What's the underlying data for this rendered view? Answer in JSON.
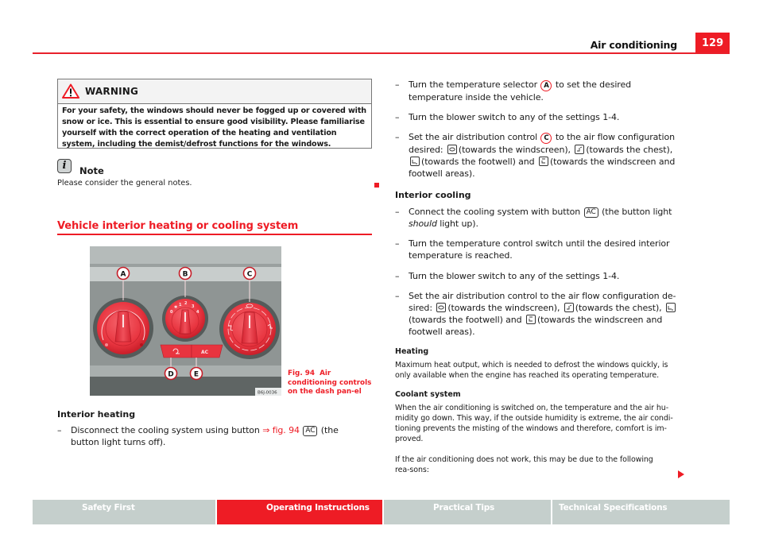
{
  "header": {
    "section_title": "Air conditioning",
    "page_number": "129"
  },
  "warning": {
    "title": "WARNING",
    "text": "For your safety, the windows should never be fogged up or covered with snow or ice. This is essential to ensure good visibility. Please familiarise yourself with the correct operation of the heating and ventilation system, including the demist/defrost functions for the windows."
  },
  "note": {
    "title": "Note",
    "text": "Please consider the general notes."
  },
  "section": {
    "title": "Vehicle interior heating or cooling system"
  },
  "figure": {
    "callouts": [
      "A",
      "B",
      "C",
      "D",
      "E"
    ],
    "blower_settings": [
      "0",
      "✱",
      "1",
      "2",
      "3",
      "4"
    ],
    "ac_button_label": "AC",
    "image_code": "B6J-0036",
    "caption_number": "Fig. 94",
    "caption_text": "Air conditioning controls on the dash pan-el"
  },
  "interior_heating": {
    "heading": "Interior heating",
    "items": [
      {
        "dash": "–",
        "parts": [
          "Disconnect the cooling system using button ",
          "⇒ fig. 94",
          "AC",
          " (the button light turns off)."
        ]
      }
    ]
  },
  "right_column": {
    "heating_steps": [
      {
        "dash": "–",
        "pre": "Turn the temperature selector ",
        "label": "A",
        "post": " to set the desired temperature inside the vehicle."
      },
      {
        "dash": "–",
        "text": "Turn the blower switch to any of the settings 1-4."
      },
      {
        "dash": "–",
        "pre": "Set the air distribution control ",
        "label": "C",
        "post": " to the air flow configuration desired:",
        "modes": [
          "(towards the windscreen),",
          "(towards the chest),",
          "(towards the footwell) and",
          "(towards the windscreen and footwell areas)."
        ]
      }
    ],
    "cooling": {
      "heading": "Interior cooling",
      "steps": [
        {
          "dash": "–",
          "pre": "Connect the cooling system with button ",
          "kbd": "AC",
          "post": " (the button light",
          "italic": "should",
          "post2": " light up)."
        },
        {
          "dash": "–",
          "text": "Turn the temperature control switch until the desired interior temperature is reached."
        },
        {
          "dash": "–",
          "text": "Turn the blower switch to any of the settings 1-4."
        },
        {
          "dash": "–",
          "pre": "Set the air distribution control to the air flow configuration de-sired:",
          "modes": [
            "(towards the windscreen),",
            "(towards the chest),",
            "(towards the footwell) and",
            "(towards the windscreen and footwell areas)."
          ]
        }
      ]
    },
    "heating_info": {
      "heading": "Heating",
      "text": "Maximum heat output, which is needed to defrost the windows quickly, is only available when the engine has reached its operating temperature."
    },
    "coolant": {
      "heading": "Coolant system",
      "text": "When the air conditioning is switched on, the temperature and the air hu-midity go down. This way, if the outside humidity is extreme, the air condi-tioning prevents the misting of the windows and therefore, comfort is im-proved.",
      "text2": "If the air conditioning does not work, this may be due to the following rea-sons:"
    }
  },
  "footer": {
    "tabs": [
      {
        "label": "Safety First",
        "active": false
      },
      {
        "label": "Operating Instructions",
        "active": true
      },
      {
        "label": "Practical Tips",
        "active": false
      },
      {
        "label": "Technical Specifications",
        "active": false
      }
    ]
  },
  "colors": {
    "accent": "#ee1c25",
    "footer_tab": "#c5cfcc",
    "dial_red": "#e8343f",
    "panel_gray": "#8f9594"
  }
}
